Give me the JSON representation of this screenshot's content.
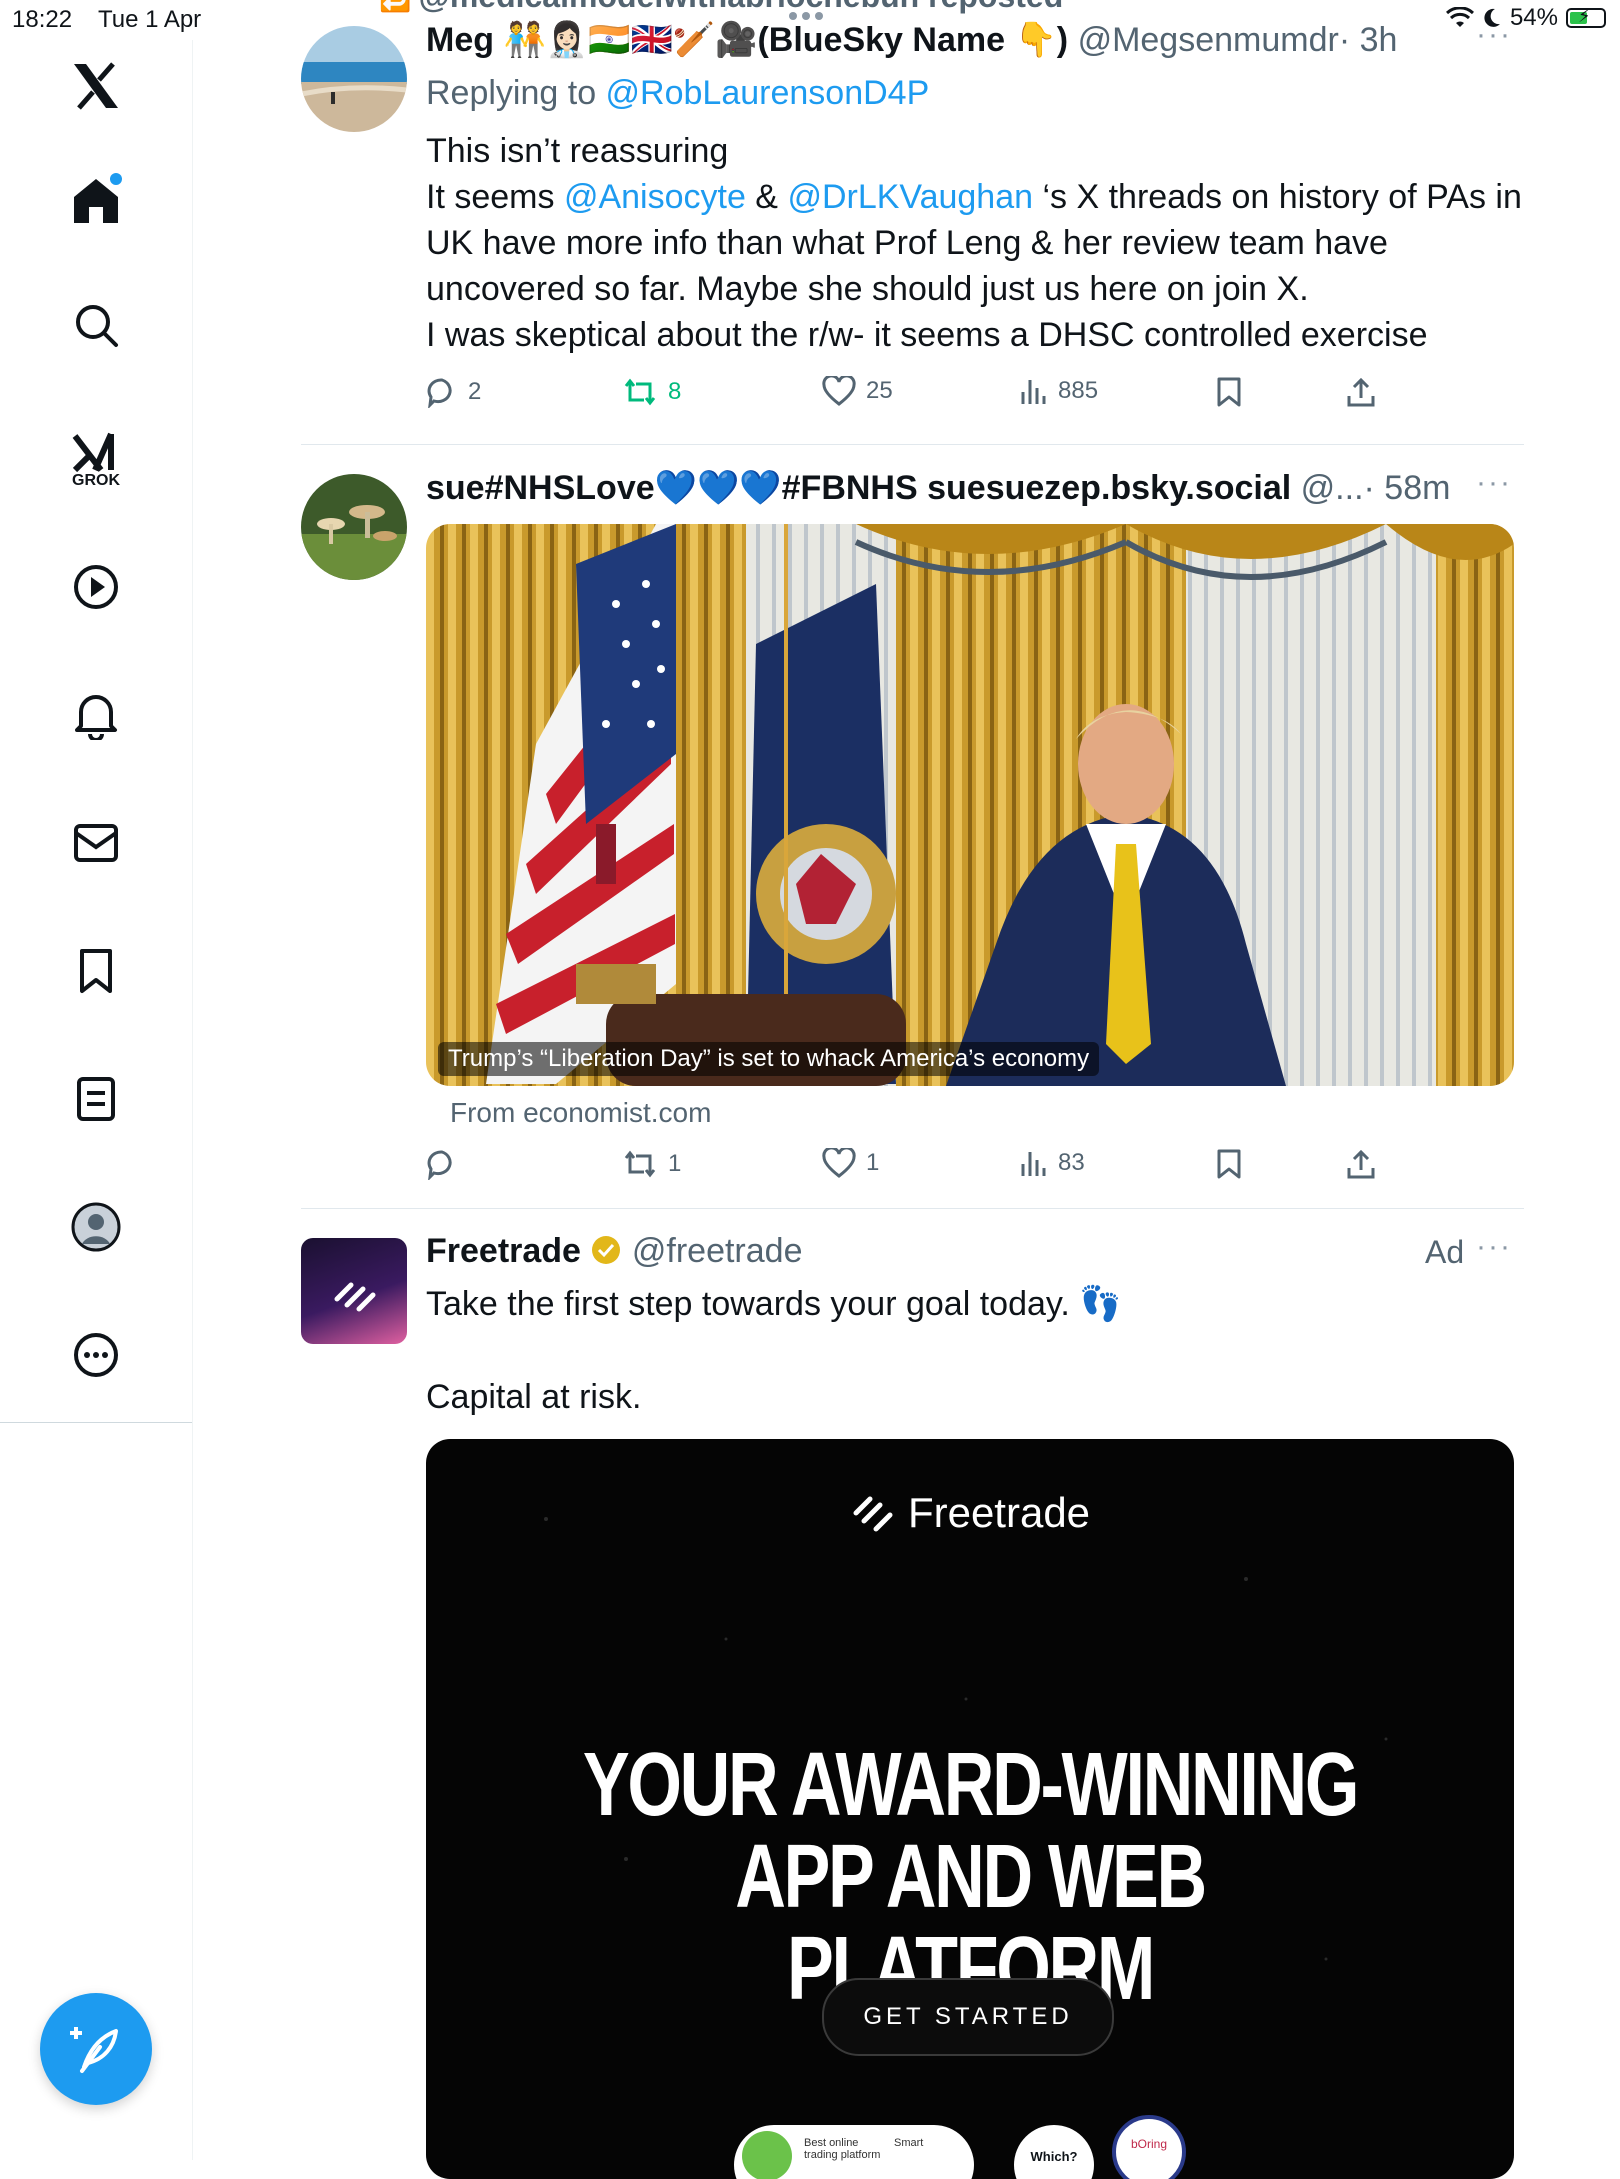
{
  "status_bar": {
    "time": "18:22",
    "date": "Tue 1 Apr",
    "battery": "54%",
    "battery_level": 0.54
  },
  "sidebar": {
    "items": [
      {
        "name": "x-logo"
      },
      {
        "name": "home"
      },
      {
        "name": "search"
      },
      {
        "name": "grok",
        "label": "GROK"
      },
      {
        "name": "video"
      },
      {
        "name": "notifications"
      },
      {
        "name": "messages"
      },
      {
        "name": "bookmarks"
      },
      {
        "name": "lists"
      },
      {
        "name": "profile"
      },
      {
        "name": "more"
      }
    ]
  },
  "repost_banner": "@medicalmodelwithabriochebun reposted",
  "tweets": [
    {
      "name": "Meg 🧑‍🤝‍🧑👩🏻‍⚕️🇮🇳🇬🇧🏏🎥(BlueSky Name 👇)",
      "handle": "@Megsenmumdr",
      "time": "· 3h",
      "replying_prefix": "Replying to ",
      "replying_to": "@RobLaurensonD4P",
      "lines": {
        "l1": "This isn’t reassuring",
        "l2_a": "It seems ",
        "l2_m1": "@Anisocyte",
        "l2_b": " & ",
        "l2_m2": "@DrLKVaughan",
        "l2_c": " ‘s X threads on history of PAs in",
        "l3": "UK have more info than what Prof Leng & her review team have",
        "l4": "uncovered so far. Maybe she should just us here on join X.",
        "l5": "I was skeptical about the r/w- it seems a DHSC controlled exercise"
      },
      "replies": "2",
      "reposts": "8",
      "likes": "25",
      "views": "885"
    },
    {
      "name": "sue#NHSLove💙💙💙#FBNHS suesuezep.bsky.social",
      "handle": "@...",
      "time": "· 58m",
      "card_caption": "Trump’s “Liberation Day” is set to whack America’s economy",
      "card_source": "From economist.com",
      "replies": "",
      "reposts": "1",
      "likes": "1",
      "views": "83"
    },
    {
      "name": "Freetrade",
      "handle": "@freetrade",
      "ad_label": "Ad",
      "text1": "Take the first step towards your goal today. 👣",
      "text2": "Capital at risk.",
      "ad_brand": "Freetrade",
      "ad_headline_1": "YOUR AWARD-WINNING",
      "ad_headline_2": "APP AND WEB PLATFORM",
      "ad_cta": "GET STARTED",
      "badges": {
        "b1_line1": "Best online",
        "b1_line2": "trading platform",
        "b1_small": "Smart",
        "b2": "Which?",
        "b3": "bOring"
      }
    }
  ]
}
